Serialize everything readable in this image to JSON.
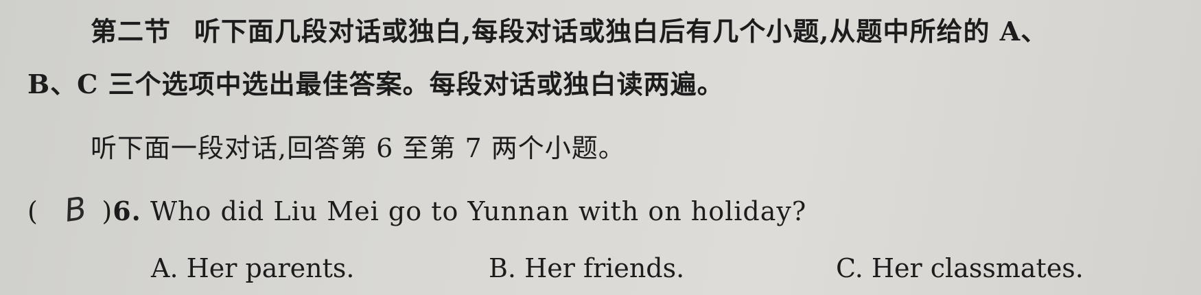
{
  "section": {
    "label": "第二节",
    "instruction_line1": "听下面几段对话或独白,每段对话或独白后有几个小题,从题中所给的 A、",
    "instruction_line2": "B、C 三个选项中选出最佳答案。每段对话或独白读两遍。"
  },
  "prompt": "听下面一段对话,回答第 6 至第 7 两个小题。",
  "question": {
    "paren_open": "(",
    "answer_mark": "B",
    "paren_close": ")",
    "number": "6.",
    "text": " Who did Liu Mei go to Yunnan with on holiday?",
    "options": [
      {
        "letter": "A.",
        "text": " Her parents."
      },
      {
        "letter": "B.",
        "text": " Her friends."
      },
      {
        "letter": "C.",
        "text": " Her classmates."
      }
    ]
  }
}
